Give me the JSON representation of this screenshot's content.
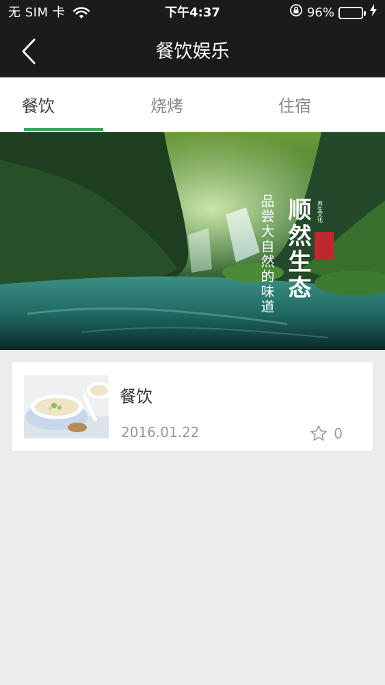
{
  "status_bar": {
    "carrier": "无 SIM 卡",
    "time": "下午4:37",
    "battery_percent": "96%",
    "battery_level": 0.96,
    "battery_color": "#35c759",
    "icons": [
      "wifi-icon",
      "lock-rotation-icon",
      "battery-icon",
      "charging-bolt-icon"
    ]
  },
  "nav": {
    "title": "餐饮娱乐",
    "back_icon": "chevron-left-icon"
  },
  "tabs": [
    {
      "label": "餐饮",
      "active": true
    },
    {
      "label": "烧烤",
      "active": false
    },
    {
      "label": "住宿",
      "active": false
    }
  ],
  "accent_color": "#3aa55d",
  "banner": {
    "heading": "顺然生态",
    "tagline": "品尝大自然的味道",
    "seal_text": "养生文化"
  },
  "list": [
    {
      "title": "餐饮",
      "date": "2016.01.22",
      "favorites": "0",
      "fav_icon": "star-outline-icon"
    }
  ]
}
